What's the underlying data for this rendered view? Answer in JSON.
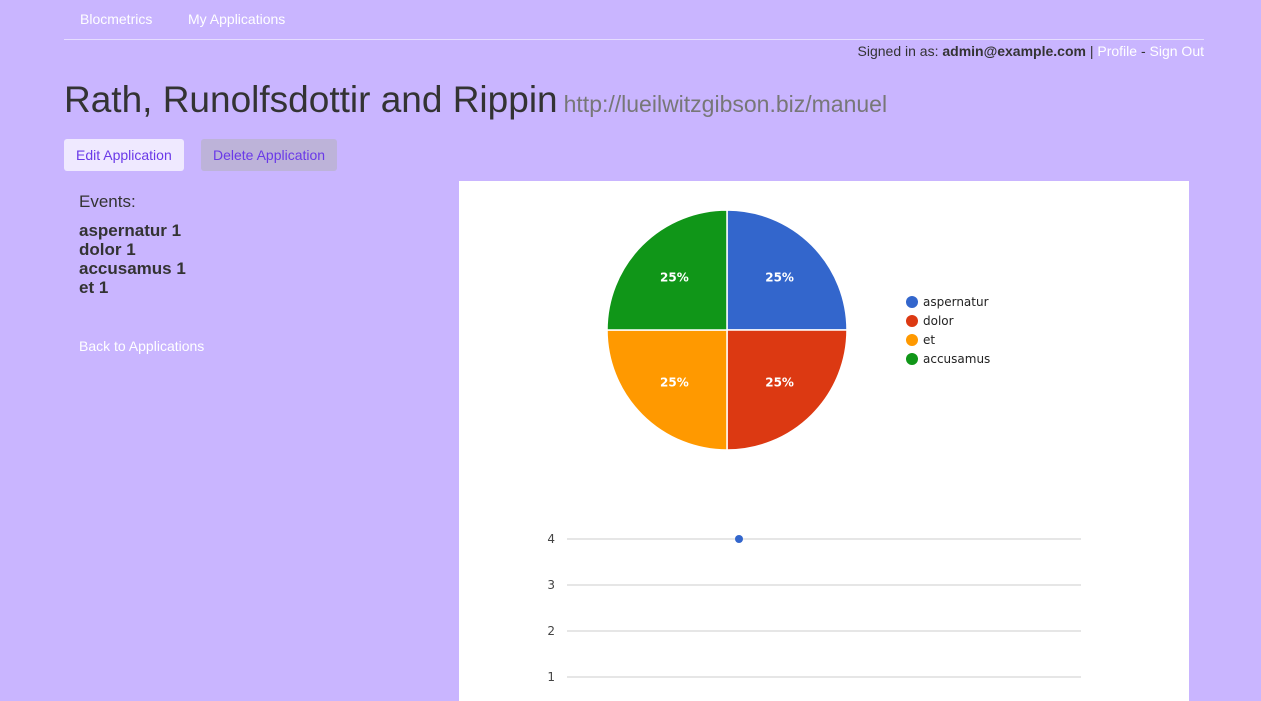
{
  "nav": {
    "brand": "Blocmetrics",
    "my_apps": "My Applications"
  },
  "auth": {
    "prefix": "Signed in as: ",
    "email": "admin@example.com",
    "sep1": " | ",
    "profile": "Profile",
    "sep2": " - ",
    "sign_out": "Sign Out"
  },
  "app": {
    "name": "Rath, Runolfsdottir and Rippin",
    "url": "http://lueilwitzgibson.biz/manuel"
  },
  "actions": {
    "edit": "Edit Application",
    "delete": "Delete Application"
  },
  "events": {
    "heading": "Events:",
    "items": [
      {
        "label": "aspernatur 1"
      },
      {
        "label": "dolor 1"
      },
      {
        "label": "accusamus 1"
      },
      {
        "label": "et 1"
      }
    ]
  },
  "back_link": "Back to Applications",
  "chart_data": [
    {
      "type": "pie",
      "categories": [
        "aspernatur",
        "dolor",
        "et",
        "accusamus"
      ],
      "values": [
        1,
        1,
        1,
        1
      ],
      "data_labels": [
        "25%",
        "25%",
        "25%",
        "25%"
      ],
      "colors": [
        "#3366cc",
        "#dc3912",
        "#ff9900",
        "#109618"
      ],
      "legend": "right"
    },
    {
      "type": "scatter",
      "x": [
        1
      ],
      "y": [
        4
      ],
      "y_ticks": [
        "4",
        "3",
        "2",
        "1"
      ],
      "color": "#3366cc",
      "grid": true
    }
  ]
}
